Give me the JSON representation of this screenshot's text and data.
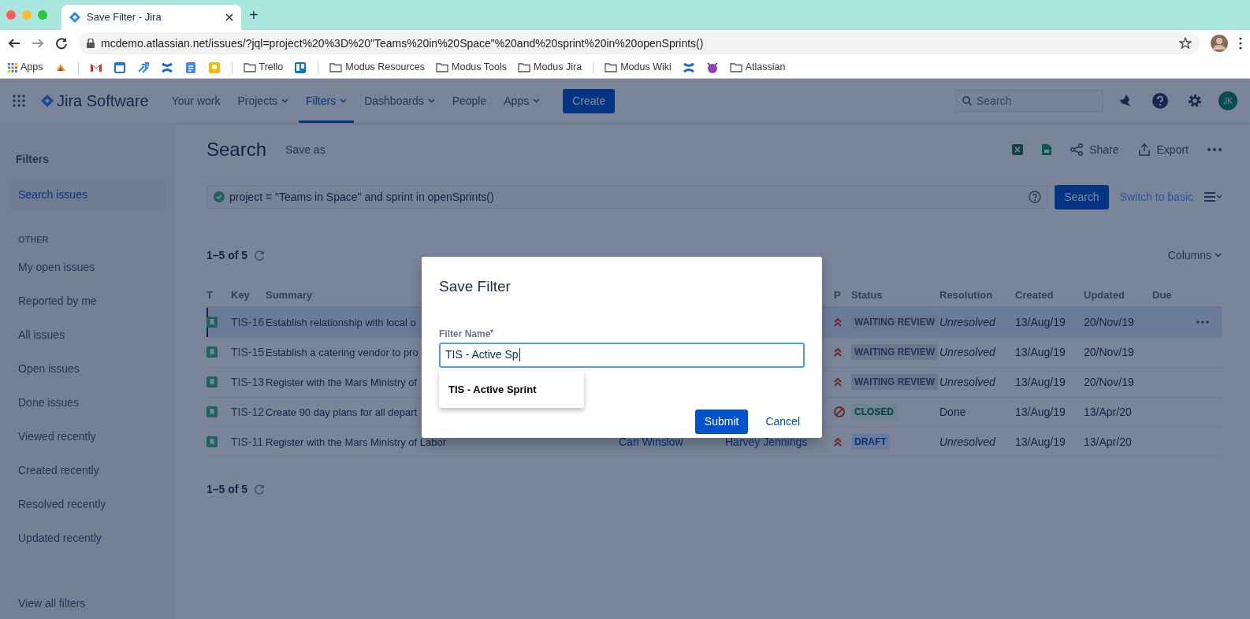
{
  "browser": {
    "tabs": [
      {
        "title": "Save Filter - Jira",
        "selected": true
      }
    ],
    "new_tab": "+",
    "url": "mcdemo.atlassian.net/issues/?jql=project%20%3D%20\"Teams%20in%20Space\"%20and%20sprint%20in%20openSprints()",
    "bookmarks": [
      {
        "kind": "apps",
        "label": "Apps"
      },
      {
        "kind": "icon"
      },
      {
        "kind": "divider"
      },
      {
        "kind": "icon"
      },
      {
        "kind": "icon"
      },
      {
        "kind": "icon"
      },
      {
        "kind": "icon"
      },
      {
        "kind": "icon"
      },
      {
        "kind": "icon"
      },
      {
        "kind": "divider"
      },
      {
        "kind": "folder",
        "label": "Trello"
      },
      {
        "kind": "icon"
      },
      {
        "kind": "divider"
      },
      {
        "kind": "folder",
        "label": "Modus Resources"
      },
      {
        "kind": "folder",
        "label": "Modus Tools"
      },
      {
        "kind": "folder",
        "label": "Modus Jira"
      },
      {
        "kind": "divider"
      },
      {
        "kind": "folder",
        "label": "Modus Wiki"
      },
      {
        "kind": "icon"
      },
      {
        "kind": "icon"
      },
      {
        "kind": "folder",
        "label": "Atlassian"
      }
    ]
  },
  "header": {
    "product": "Jira Software",
    "nav": [
      {
        "label": "Your work",
        "dropdown": false,
        "selected": false
      },
      {
        "label": "Projects",
        "dropdown": true,
        "selected": false
      },
      {
        "label": "Filters",
        "dropdown": true,
        "selected": true
      },
      {
        "label": "Dashboards",
        "dropdown": true,
        "selected": false
      },
      {
        "label": "People",
        "dropdown": false,
        "selected": false
      },
      {
        "label": "Apps",
        "dropdown": true,
        "selected": false
      }
    ],
    "create": "Create",
    "search_placeholder": "Search",
    "avatar": "JK"
  },
  "sidebar": {
    "title": "Filters",
    "items": [
      {
        "label": "Search issues",
        "selected": true
      }
    ],
    "section": "OTHER",
    "other_items": [
      {
        "label": "My open issues",
        "selected": false
      },
      {
        "label": "Reported by me",
        "selected": false
      },
      {
        "label": "All issues",
        "selected": false
      },
      {
        "label": "Open issues",
        "selected": false
      },
      {
        "label": "Done issues",
        "selected": false
      },
      {
        "label": "Viewed recently",
        "selected": false
      },
      {
        "label": "Created recently",
        "selected": false
      },
      {
        "label": "Resolved recently",
        "selected": false
      },
      {
        "label": "Updated recently",
        "selected": false
      }
    ],
    "footer": "View all filters"
  },
  "search": {
    "title": "Search",
    "save_as": "Save as",
    "actions": [
      "Share",
      "Export"
    ],
    "jql": "project = \"Teams in Space\" and sprint in openSprints()",
    "search_button": "Search",
    "switch": "Switch to basic"
  },
  "results": {
    "count_top": "1–5 of 5",
    "columns_button": "Columns",
    "count_bottom": "1–5 of 5",
    "columns": [
      "T",
      "Key",
      "Summary",
      "",
      "",
      "P",
      "Status",
      "Resolution",
      "Created",
      "Updated",
      "Due"
    ],
    "rows": [
      {
        "key": "TIS-16",
        "summary": "Establish relationship with local o",
        "priority": {
          "kind": "high"
        },
        "status": {
          "label": "WAITING REVIEW",
          "kind": "review"
        },
        "resolution": "Unresolved",
        "resolved": false,
        "created": "13/Aug/19",
        "updated": "20/Nov/19",
        "selected": true
      },
      {
        "key": "TIS-15",
        "summary": "Establish a catering vendor to pro",
        "priority": {
          "kind": "high"
        },
        "status": {
          "label": "WAITING REVIEW",
          "kind": "review"
        },
        "resolution": "Unresolved",
        "resolved": false,
        "created": "13/Aug/19",
        "updated": "20/Nov/19",
        "selected": false
      },
      {
        "key": "TIS-13",
        "summary": "Register with the Mars Ministry of",
        "priority": {
          "kind": "high"
        },
        "status": {
          "label": "WAITING REVIEW",
          "kind": "review"
        },
        "resolution": "Unresolved",
        "resolved": false,
        "created": "13/Aug/19",
        "updated": "20/Nov/19",
        "selected": false
      },
      {
        "key": "TIS-12",
        "summary": "Create 90 day plans for all depart",
        "priority": {
          "kind": "blocker"
        },
        "status": {
          "label": "CLOSED",
          "kind": "done"
        },
        "resolution": "Done",
        "resolved": true,
        "created": "13/Aug/19",
        "updated": "13/Apr/20",
        "selected": false
      },
      {
        "key": "TIS-11",
        "summary": "Register with the Mars Ministry of Labor",
        "assignee": "Cari Winslow",
        "reporter": "Harvey Jennings",
        "priority": {
          "kind": "high"
        },
        "status": {
          "label": "DRAFT",
          "kind": "draft"
        },
        "resolution": "Unresolved",
        "resolved": false,
        "created": "13/Aug/19",
        "updated": "13/Apr/20",
        "selected": false
      }
    ]
  },
  "dialog": {
    "title": "Save Filter",
    "label": "Filter Name",
    "required_mark": "*",
    "value": "TIS - Active Sp",
    "suggestion": "TIS - Active Sprint",
    "submit": "Submit",
    "cancel": "Cancel"
  }
}
